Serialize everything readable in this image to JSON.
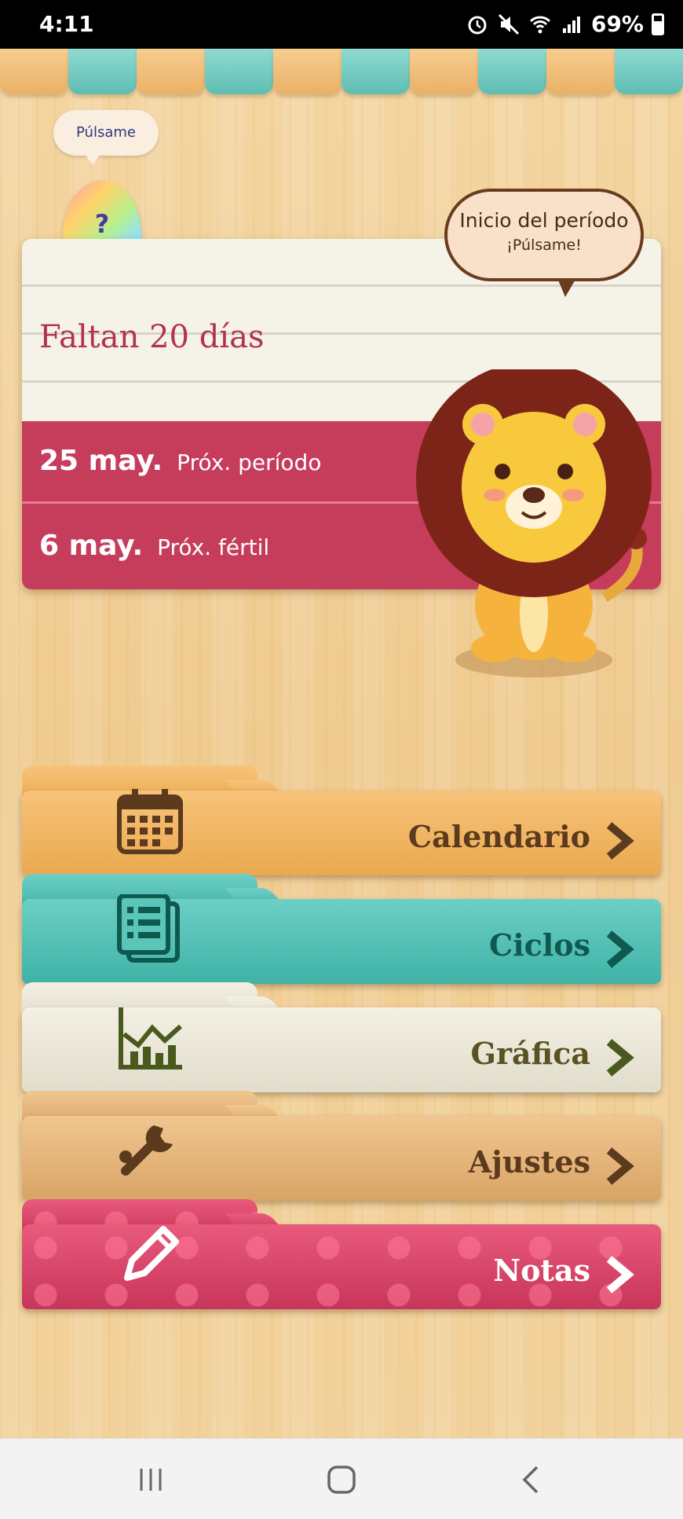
{
  "status_bar": {
    "time": "4:11",
    "battery": "69%"
  },
  "app": {
    "hint_bubble": "Púlsame",
    "egg_symbol": "?",
    "speech": {
      "title": "Inicio del período",
      "subtitle": "¡Púlsame!"
    },
    "countdown": "Faltan 20 días",
    "next_period": {
      "date": "25 may.",
      "label": "Próx. período"
    },
    "next_fertile": {
      "date": "6 may.",
      "label": "Próx. fértil"
    }
  },
  "menu": [
    {
      "label": "Calendario",
      "icon": "calendar-icon"
    },
    {
      "label": "Ciclos",
      "icon": "list-icon"
    },
    {
      "label": "Gráfica",
      "icon": "chart-icon"
    },
    {
      "label": "Ajustes",
      "icon": "wrench-icon"
    },
    {
      "label": "Notas",
      "icon": "pencil-icon"
    }
  ],
  "colors": {
    "accent": "#c63d5c",
    "awning_orange": "#f2c07a",
    "awning_teal": "#6fcfc4"
  }
}
